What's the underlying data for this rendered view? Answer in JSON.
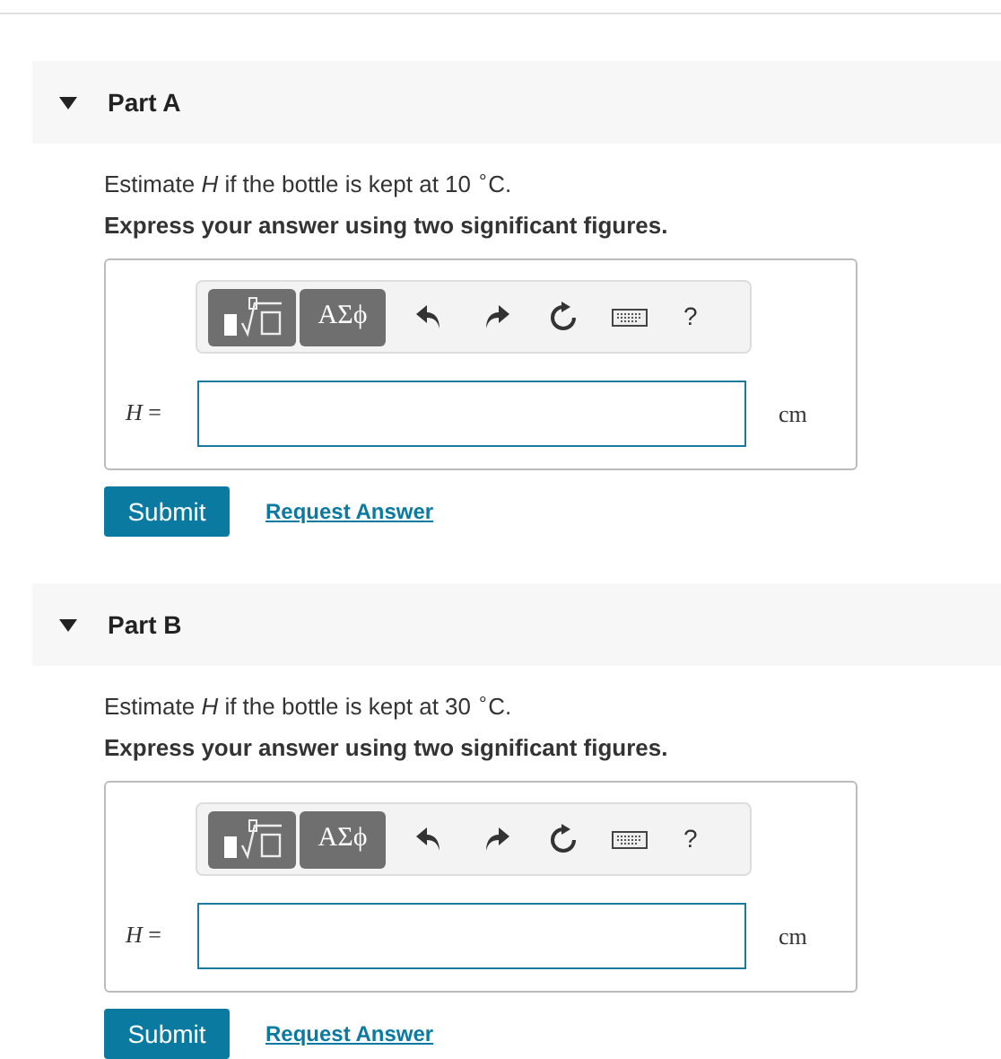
{
  "parts": [
    {
      "title": "Part A",
      "expanded": true,
      "question": "Estimate *H* if the bottle is kept at 10 $^{∘}$C.",
      "instruction": "Express your answer using two significant figures.",
      "toolbar": {
        "symbols_button": "ΑΣϕ",
        "help": "?"
      },
      "variable": "*H* =",
      "units": "cm",
      "submit": "Submit",
      "request": "Request Answer"
    },
    {
      "title": "Part B",
      "expanded": true,
      "question": "Estimate *H* if the bottle is kept at 30 $^{∘}$C.",
      "instruction": "Express your answer using two significant figures.",
      "toolbar": {
        "symbols_button": "ΑΣϕ",
        "help": "?"
      },
      "variable": "*H* =",
      "units": "cm",
      "submit": "Submit",
      "request": "Request Answer"
    }
  ]
}
